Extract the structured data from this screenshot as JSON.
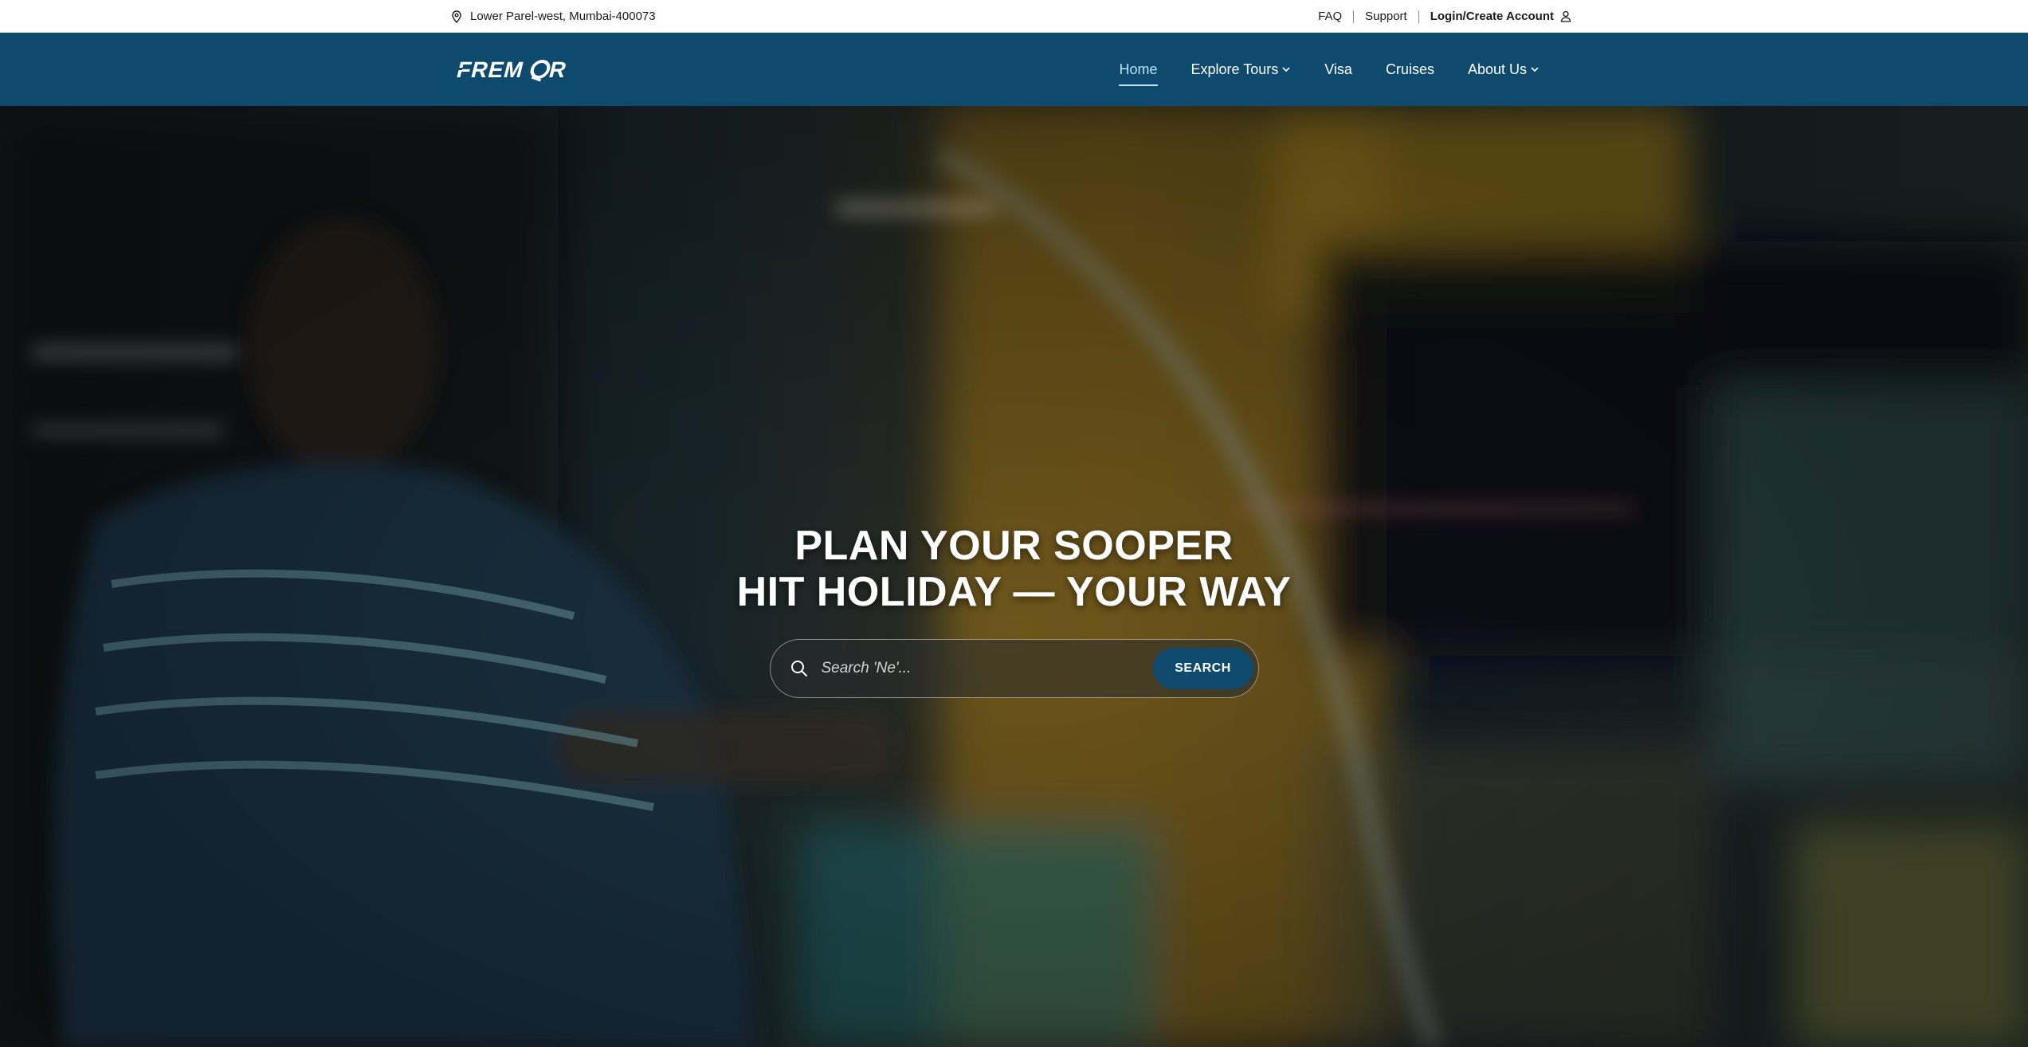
{
  "topbar": {
    "location": "Lower Parel-west, Mumbai-400073",
    "links": {
      "faq": "FAQ",
      "support": "Support",
      "login": "Login/Create Account"
    }
  },
  "brand": {
    "logo_text": "FREMOR"
  },
  "nav": {
    "items": [
      {
        "label": "Home",
        "active": true
      },
      {
        "label": "Explore Tours",
        "has_dropdown": true
      },
      {
        "label": "Visa"
      },
      {
        "label": "Cruises"
      },
      {
        "label": "About Us",
        "has_dropdown": true
      }
    ]
  },
  "hero": {
    "title_line1": "PLAN YOUR SOOPER",
    "title_line2": "HIT HOLIDAY — YOUR WAY",
    "search": {
      "placeholder": "Search 'Ne'...",
      "button_label": "SEARCH"
    }
  },
  "colors": {
    "nav_bg": "#0d4a6e",
    "topbar_bg": "#ffffff",
    "active_link": "#bfe3ff",
    "button_bg": "#0d4a6e"
  },
  "icons": {
    "location": "map-pin-icon",
    "user": "user-icon",
    "dropdown": "chevron-down-icon",
    "search": "search-icon"
  }
}
